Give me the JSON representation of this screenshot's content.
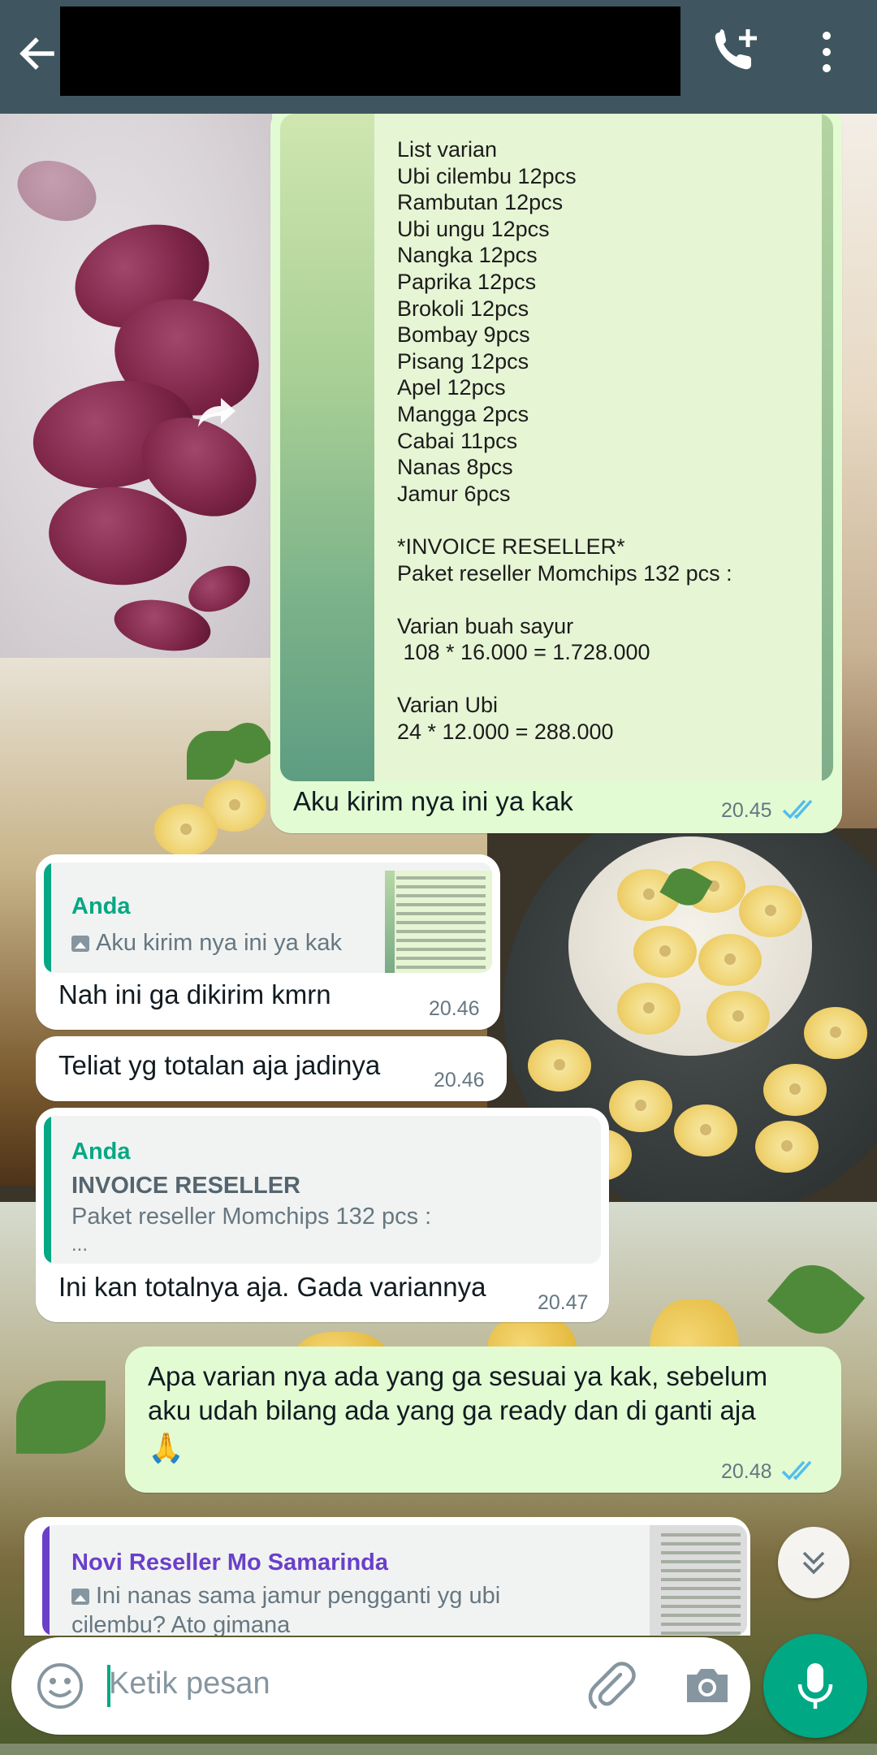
{
  "header": {
    "back_icon": "arrow-left-icon",
    "call_icon": "add-call-icon",
    "menu_icon": "more-vertical-icon",
    "contact_name_redacted": true
  },
  "messages": {
    "image_message": {
      "doc_lines": [
        "List varian",
        "Ubi cilembu 12pcs",
        "Rambutan 12pcs",
        "Ubi ungu 12pcs",
        "Nangka 12pcs",
        "Paprika 12pcs",
        "Brokoli 12pcs",
        "Bombay 9pcs",
        "Pisang 12pcs",
        "Apel 12pcs",
        "Mangga 2pcs",
        "Cabai 11pcs",
        "Nanas 8pcs",
        "Jamur 6pcs",
        "",
        "*INVOICE RESELLER*",
        "Paket reseller Momchips 132 pcs :",
        "",
        "Varian buah sayur",
        " 108 * 16.000 = 1.728.000",
        "",
        "Varian Ubi",
        "24 * 12.000 = 288.000"
      ],
      "caption": "Aku kirim nya ini ya kak",
      "time": "20.45"
    },
    "reply1": {
      "quote_author": "Anda",
      "quote_text": "Aku kirim nya ini ya kak",
      "text": "Nah ini ga dikirim kmrn",
      "time": "20.46"
    },
    "msg2": {
      "text": "Teliat yg totalan aja jadinya",
      "time": "20.46"
    },
    "reply3": {
      "quote_author": "Anda",
      "quote_title": "INVOICE RESELLER",
      "quote_text": "Paket reseller Momchips 132 pcs :",
      "quote_more": "...",
      "text": "Ini kan totalnya aja. Gada variannya",
      "time": "20.47"
    },
    "out4": {
      "line1": "Apa varian nya ada yang ga sesuai ya kak, sebelum",
      "line2": "aku udah bilang ada yang ga ready dan di ganti aja",
      "emoji": "🙏",
      "time": "20.48"
    },
    "reply5": {
      "quote_author": "Novi Reseller Mo Samarinda",
      "quote_line1": "Ini nanas sama jamur pengganti yg ubi",
      "quote_line2": "cilembu? Ato gimana"
    }
  },
  "input": {
    "placeholder": "Ketik pesan",
    "emoji_icon": "emoji-icon",
    "attach_icon": "paperclip-icon",
    "camera_icon": "camera-icon",
    "mic_icon": "mic-icon"
  },
  "colors": {
    "header": "#3f5660",
    "outgoing_bubble": "#e2fbd3",
    "incoming_bubble": "#ffffff",
    "accent_green": "#00a884",
    "quote_green": "#06a884",
    "quote_purple": "#6a3fc9",
    "read_ticks": "#53bdeb"
  }
}
